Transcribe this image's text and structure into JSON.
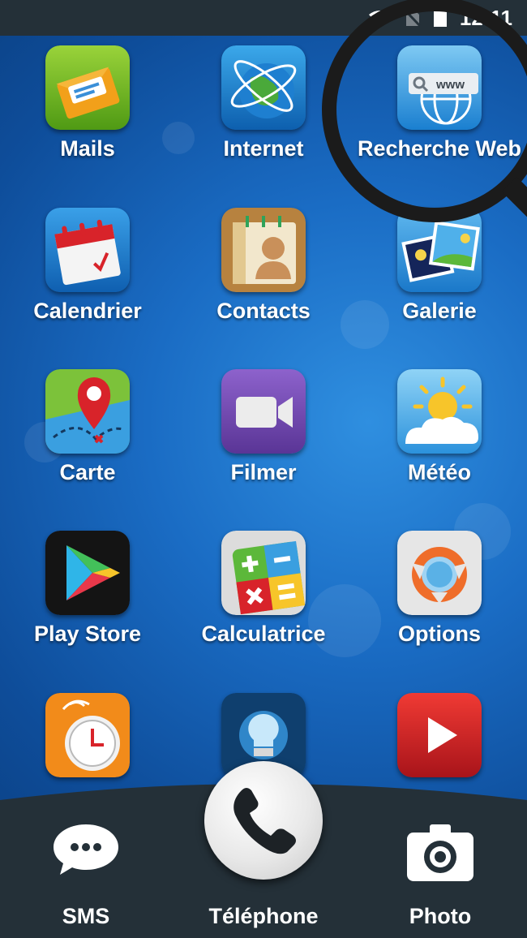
{
  "status_bar": {
    "time": "12:11"
  },
  "apps": [
    {
      "label": "Mails",
      "icon": "mail-icon"
    },
    {
      "label": "Internet",
      "icon": "globe-icon"
    },
    {
      "label": "Recherche Web",
      "icon": "web-search-icon"
    },
    {
      "label": "Calendrier",
      "icon": "calendar-icon"
    },
    {
      "label": "Contacts",
      "icon": "contacts-icon"
    },
    {
      "label": "Galerie",
      "icon": "gallery-icon"
    },
    {
      "label": "Carte",
      "icon": "map-icon"
    },
    {
      "label": "Filmer",
      "icon": "video-camera-icon"
    },
    {
      "label": "Météo",
      "icon": "weather-icon"
    },
    {
      "label": "Play Store",
      "icon": "play-store-icon"
    },
    {
      "label": "Calculatrice",
      "icon": "calculator-icon"
    },
    {
      "label": "Options",
      "icon": "options-icon"
    },
    {
      "label": "",
      "icon": "alarm-clock-icon"
    },
    {
      "label": "",
      "icon": "lightbulb-icon"
    },
    {
      "label": "",
      "icon": "video-play-icon"
    }
  ],
  "web_search_icon_text": "www",
  "dock": {
    "sms": "SMS",
    "phone": "Téléphone",
    "photo": "Photo"
  },
  "colors": {
    "status_bar": "#243038",
    "dock": "#243038",
    "wallpaper": "#1a6cc4"
  }
}
